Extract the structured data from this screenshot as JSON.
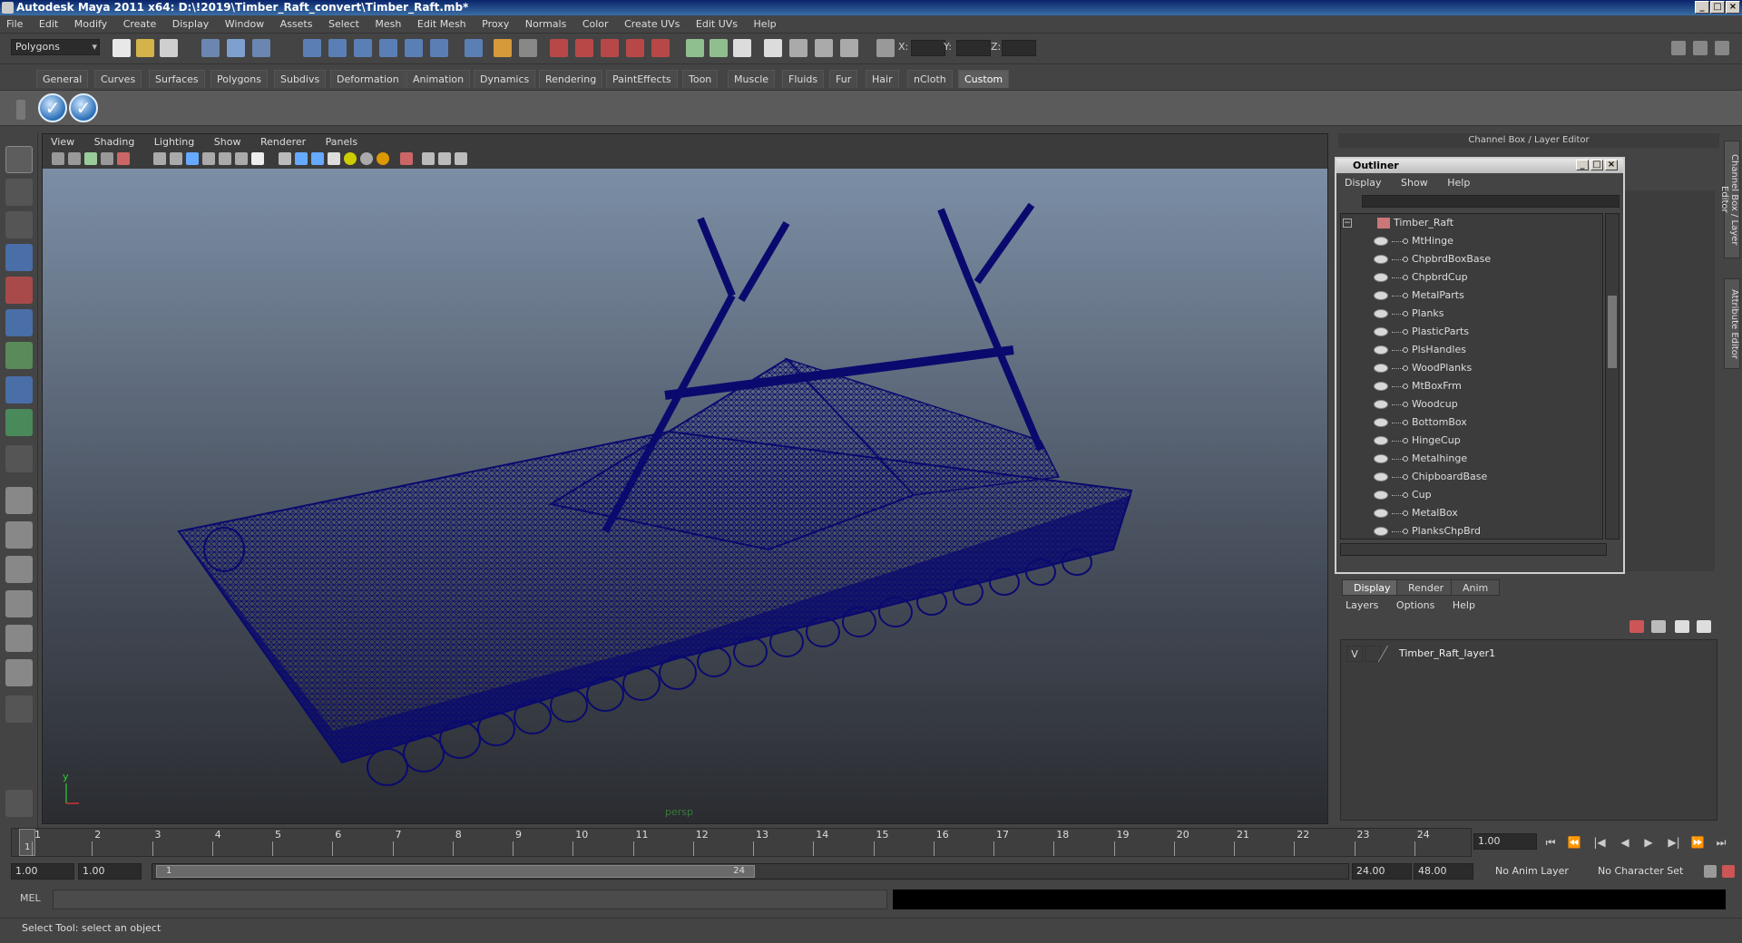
{
  "title": "Autodesk Maya 2011 x64: D:\\!2019\\Timber_Raft_convert\\Timber_Raft.mb*",
  "menu": [
    "File",
    "Edit",
    "Modify",
    "Create",
    "Display",
    "Window",
    "Assets",
    "Select",
    "Mesh",
    "Edit Mesh",
    "Proxy",
    "Normals",
    "Color",
    "Create UVs",
    "Edit UVs",
    "Help"
  ],
  "statusline": {
    "mode": "Polygons",
    "x_label": "X:",
    "y_label": "Y:",
    "z_label": "Z:"
  },
  "shelf_tabs": [
    "General",
    "Curves",
    "Surfaces",
    "Polygons",
    "Subdivs",
    "Deformation",
    "Animation",
    "Dynamics",
    "Rendering",
    "PaintEffects",
    "Toon",
    "Muscle",
    "Fluids",
    "Fur",
    "Hair",
    "nCloth",
    "Custom"
  ],
  "shelf_active": "Custom",
  "viewport": {
    "menu": [
      "View",
      "Shading",
      "Lighting",
      "Show",
      "Renderer",
      "Panels"
    ],
    "camera": "persp",
    "wire_color": "#0a0a6e"
  },
  "channel_box_header": "Channel Box / Layer Editor",
  "side_tabs": [
    "Channel Box / Layer Editor",
    "Attribute Editor"
  ],
  "outliner": {
    "title": "Outliner",
    "menu": [
      "Display",
      "Show",
      "Help"
    ],
    "root": "Timber_Raft",
    "items": [
      "MtHinge",
      "ChpbrdBoxBase",
      "ChpbrdCup",
      "MetalParts",
      "Planks",
      "PlasticParts",
      "PlsHandles",
      "WoodPlanks",
      "MtBoxFrm",
      "Woodcup",
      "BottomBox",
      "HingeCup",
      "Metalhinge",
      "ChipboardBase",
      "Cup",
      "MetalBox",
      "PlanksChpBrd"
    ]
  },
  "layer_editor": {
    "tabs": [
      "Display",
      "Render",
      "Anim"
    ],
    "active_tab": "Display",
    "menu": [
      "Layers",
      "Options",
      "Help"
    ],
    "layers": [
      {
        "visible": "V",
        "name": "Timber_Raft_layer1"
      }
    ]
  },
  "time_slider": {
    "ticks": [
      "1",
      "2",
      "3",
      "4",
      "5",
      "6",
      "7",
      "8",
      "9",
      "10",
      "11",
      "12",
      "13",
      "14",
      "15",
      "16",
      "17",
      "18",
      "19",
      "20",
      "21",
      "22",
      "23",
      "24"
    ],
    "current_frame_marker": "1",
    "current_frame": "1.00"
  },
  "range_slider": {
    "start": "1.00",
    "playback_start": "1.00",
    "range_min_label": "1",
    "range_max_label": "24",
    "playback_end": "24.00",
    "end": "48.00",
    "anim_layer": "No Anim Layer",
    "character_set": "No Character Set"
  },
  "command_line": {
    "label": "MEL"
  },
  "help_line": "Select Tool: select an object"
}
